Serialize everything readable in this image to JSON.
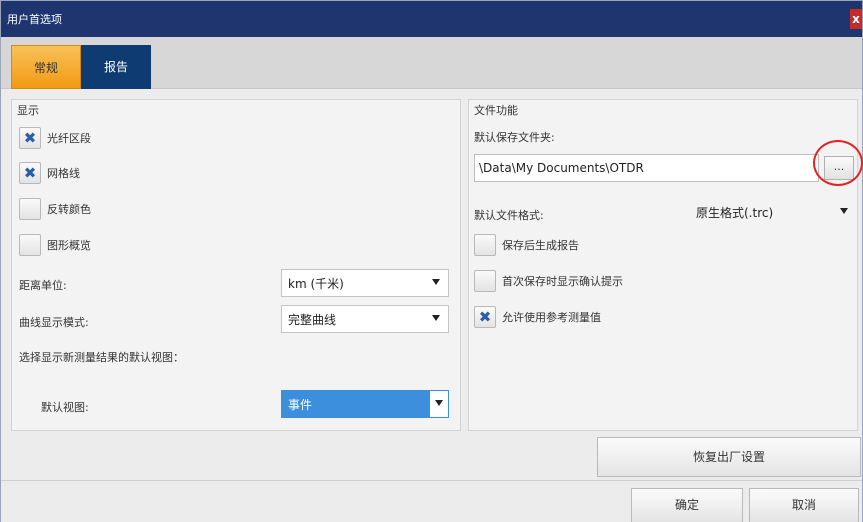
{
  "window": {
    "title": "用户首选项",
    "close_label": "x"
  },
  "tabs": [
    {
      "label": "常规",
      "active": true
    },
    {
      "label": "报告",
      "active": false
    }
  ],
  "display": {
    "section_title": "显示",
    "checkboxes": [
      {
        "label": "光纤区段",
        "checked": true
      },
      {
        "label": "网格线",
        "checked": true
      },
      {
        "label": "反转颜色",
        "checked": false
      },
      {
        "label": "图形概览",
        "checked": false
      }
    ],
    "distance_unit": {
      "label": "距离单位:",
      "value": "km (千米)"
    },
    "curve_mode": {
      "label": "曲线显示模式:",
      "value": "完整曲线"
    },
    "default_view_prompt": "选择显示新测量结果的默认视图：",
    "default_view": {
      "label": "默认视图:",
      "value": "事件"
    }
  },
  "file_function": {
    "section_title": "文件功能",
    "default_folder_label": "默认保存文件夹:",
    "default_folder_value": "\\Data\\My Documents\\OTDR",
    "browse_label": "...",
    "default_format": {
      "label": "默认文件格式:",
      "value": "原生格式(.trc)"
    },
    "checkboxes": [
      {
        "label": "保存后生成报告",
        "checked": false
      },
      {
        "label": "首次保存时显示确认提示",
        "checked": false
      },
      {
        "label": "允许使用参考测量值",
        "checked": true
      }
    ]
  },
  "buttons": {
    "reset": "恢复出厂设置",
    "ok": "确定",
    "cancel": "取消"
  },
  "colors": {
    "titlebar": "#1e3570",
    "tab_active": "#f29a12",
    "tab_inactive": "#0f3b73",
    "selected_dropdown": "#3c8fdc",
    "highlight": "#e12323"
  }
}
